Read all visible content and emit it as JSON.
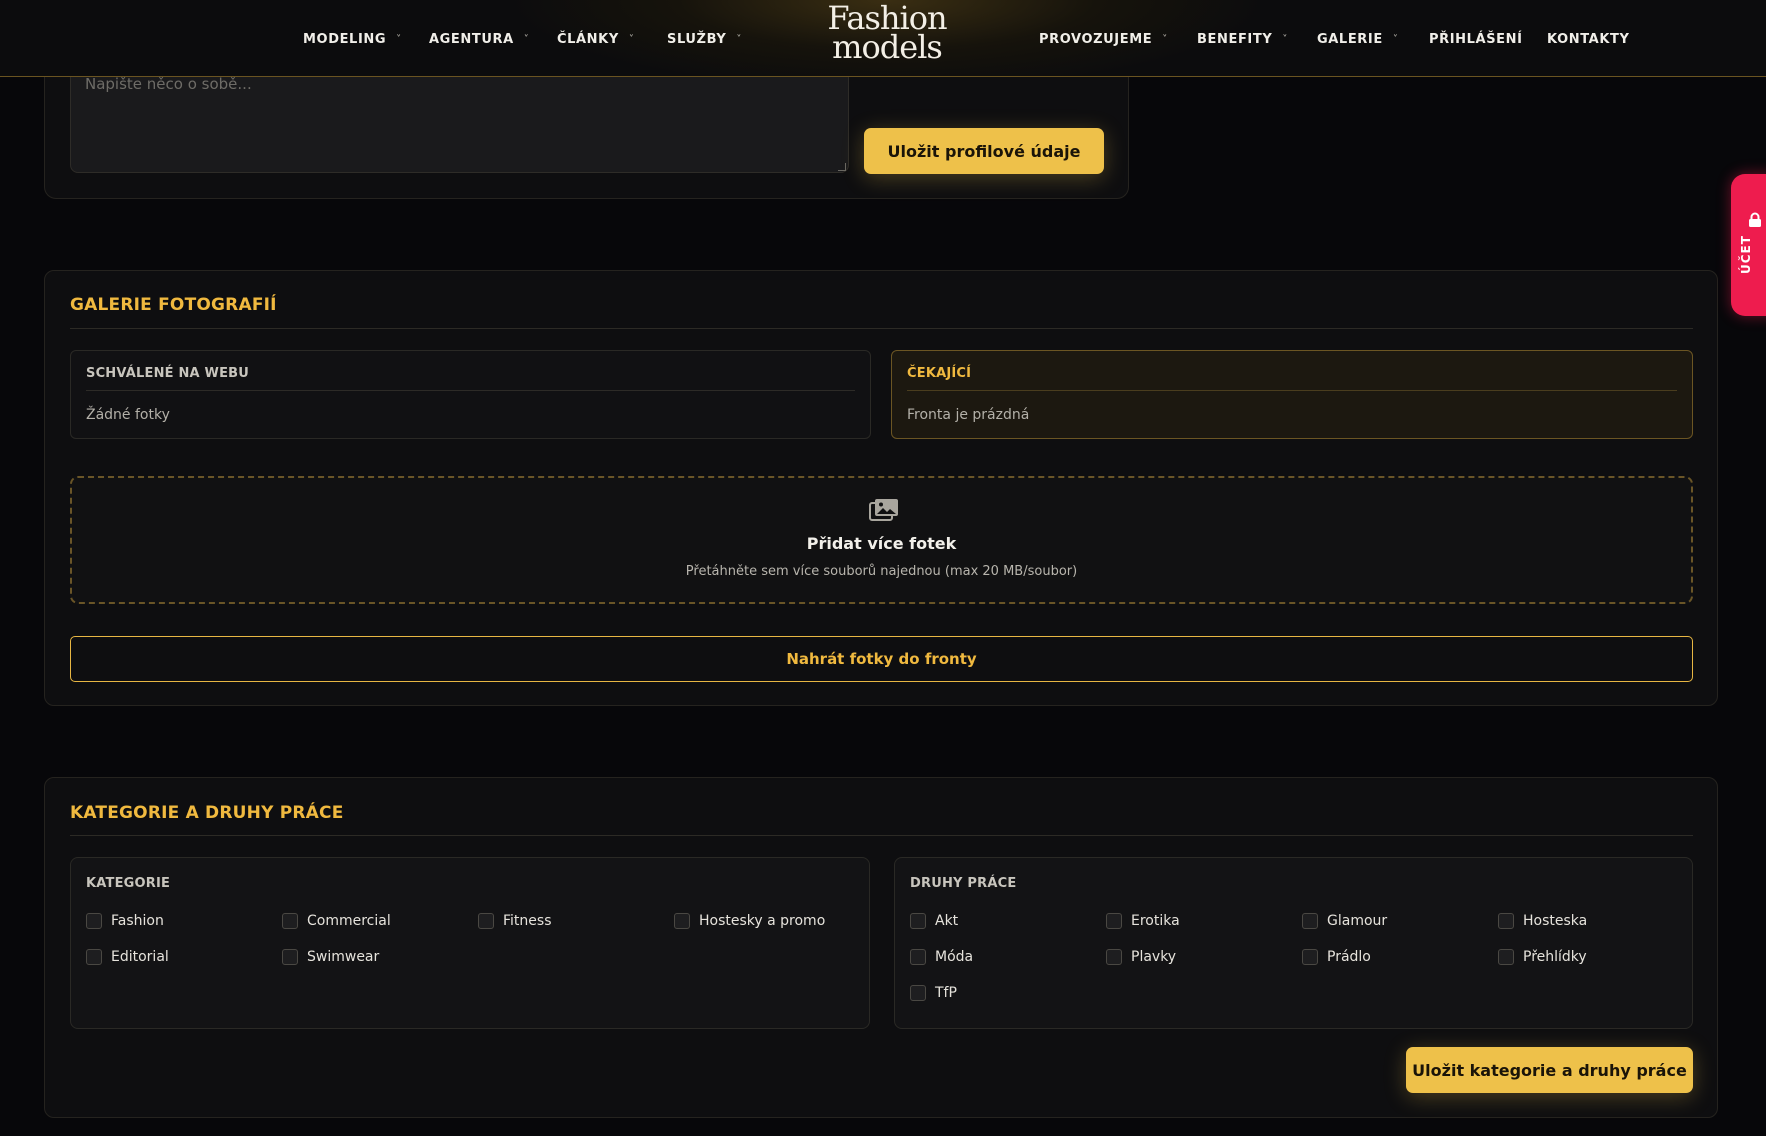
{
  "nav": {
    "left_items": [
      {
        "label": "MODELING",
        "chevron": "˅"
      },
      {
        "label": "AGENTURA",
        "chevron": "˅"
      },
      {
        "label": "ČLÁNKY",
        "chevron": "˅"
      },
      {
        "label": "SLUŽBY",
        "chevron": "˅"
      }
    ],
    "logo": {
      "line1": "Fashion",
      "line2": "models"
    },
    "right_items": [
      {
        "label": "PROVOZUJEME",
        "chevron": "˅"
      },
      {
        "label": "BENEFITY",
        "chevron": "˅"
      },
      {
        "label": "GALERIE",
        "chevron": "˅"
      },
      {
        "label": "PŘIHLÁŠENÍ"
      },
      {
        "label": "KONTAKTY"
      }
    ]
  },
  "profile": {
    "about_placeholder": "Napište něco o sobě...",
    "save_label": "Uložit profilové údaje"
  },
  "gallery": {
    "title": "GALERIE FOTOGRAFIÍ",
    "approved": {
      "title": "SCHVÁLENÉ NA WEBU",
      "empty": "Žádné fotky"
    },
    "pending": {
      "title": "ČEKAJÍCÍ",
      "empty": "Fronta je prázdná"
    },
    "dropzone": {
      "icon": "images-icon",
      "title": "Přidat více fotek",
      "subtitle": "Přetáhněte sem více souborů najednou (max 20 MB/soubor)"
    },
    "upload_label": "Nahrát fotky do fronty"
  },
  "categories": {
    "title": "KATEGORIE A DRUHY PRÁCE",
    "kategorie": {
      "title": "KATEGORIE",
      "items": [
        "Fashion",
        "Commercial",
        "Fitness",
        "Hostesky a promo",
        "Editorial",
        "Swimwear"
      ]
    },
    "druhy": {
      "title": "DRUHY PRÁCE",
      "items": [
        "Akt",
        "Erotika",
        "Glamour",
        "Hosteska",
        "Móda",
        "Plavky",
        "Prádlo",
        "Přehlídky",
        "TfP"
      ]
    },
    "save_label": "Uložit kategorie a druhy práce"
  },
  "side_tab": {
    "label": "ÚČET",
    "icon": "lock-icon"
  },
  "colors": {
    "accent": "#f0b93f",
    "button": "#eec14a",
    "side_tab": "#ee1c4e",
    "background": "#07070a"
  }
}
